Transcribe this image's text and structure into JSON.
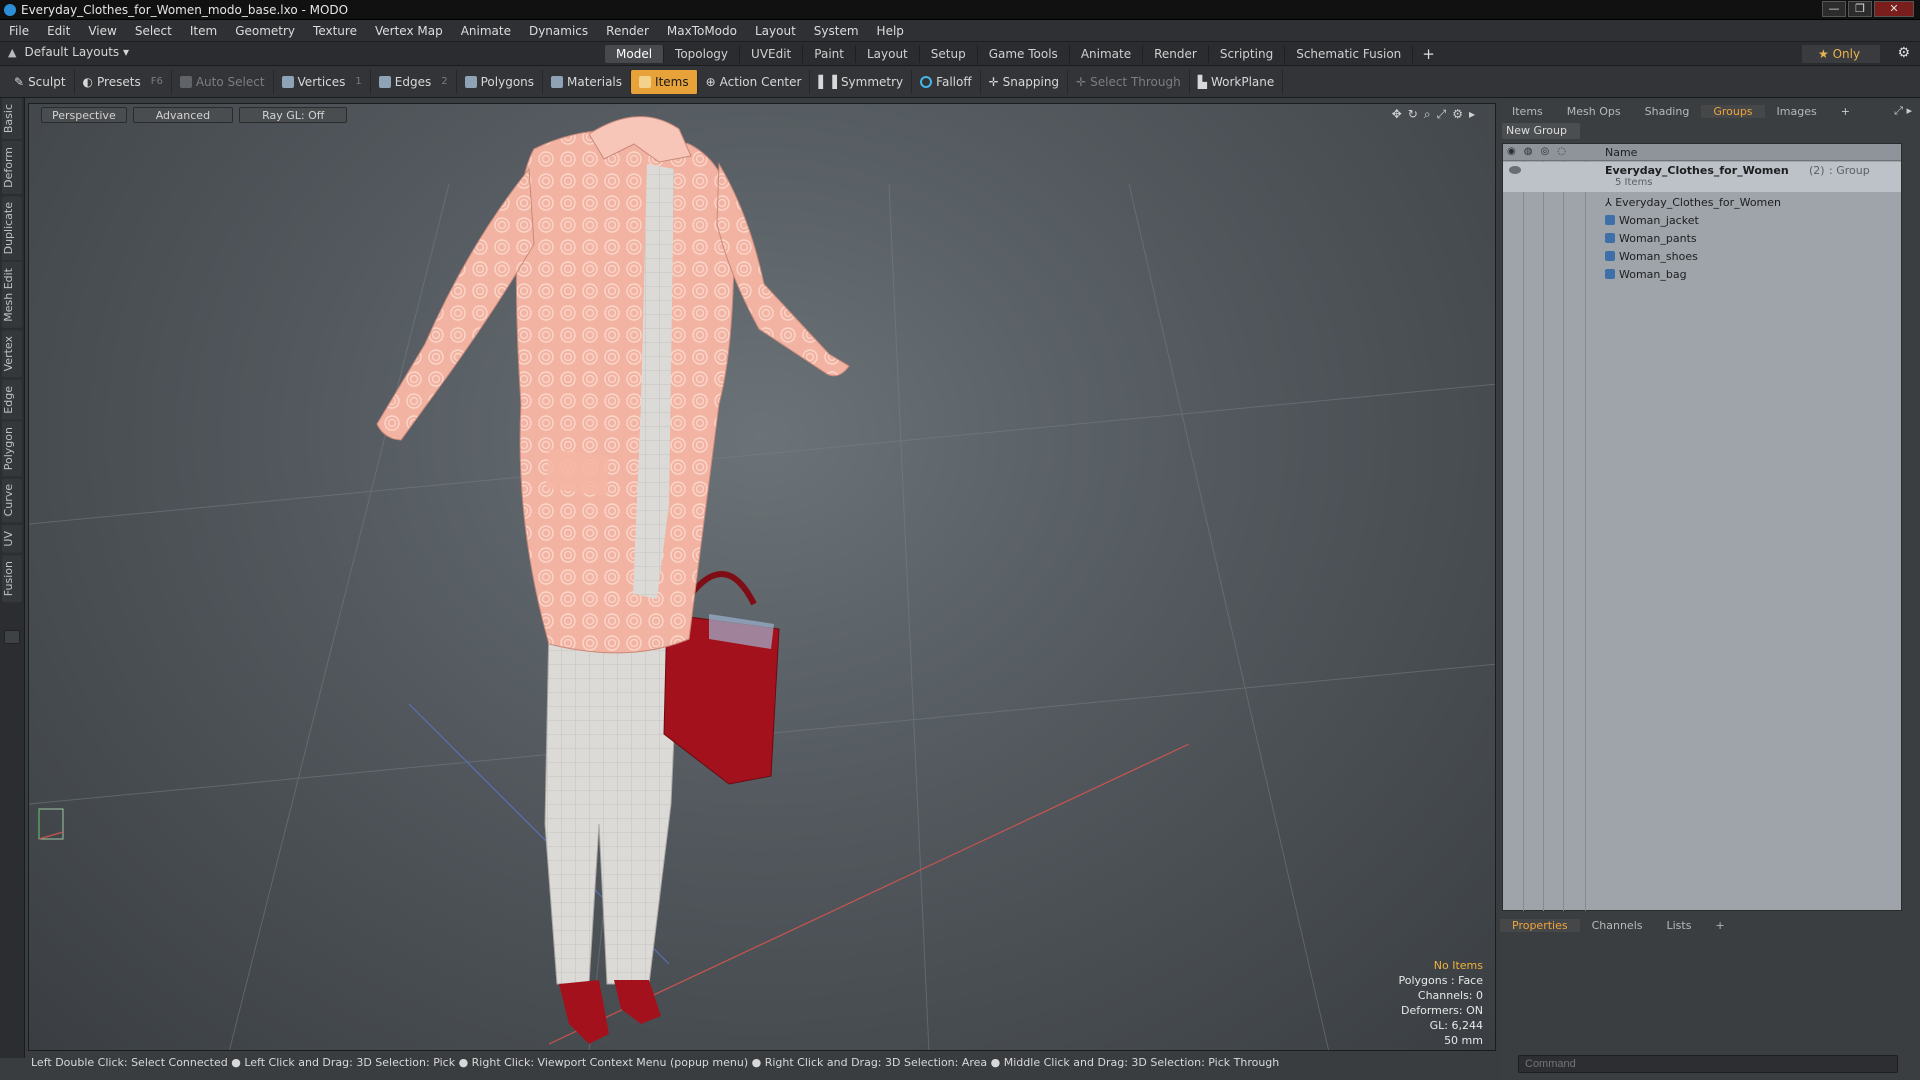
{
  "window": {
    "title": "Everyday_Clothes_for_Women_modo_base.lxo - MODO",
    "buttons": [
      "—",
      "❐",
      "✕"
    ]
  },
  "menu": [
    "File",
    "Edit",
    "View",
    "Select",
    "Item",
    "Geometry",
    "Texture",
    "Vertex Map",
    "Animate",
    "Dynamics",
    "Render",
    "MaxToModo",
    "Layout",
    "System",
    "Help"
  ],
  "layouts": {
    "label": "Default Layouts ▾"
  },
  "main_tabs": [
    "Model",
    "Topology",
    "UVEdit",
    "Paint",
    "Layout",
    "Setup",
    "Game Tools",
    "Animate",
    "Render",
    "Scripting",
    "Schematic Fusion"
  ],
  "main_tab_plus": "+",
  "only_label": "★  Only",
  "toolbar": {
    "sculpt": "Sculpt",
    "presets": "Presets",
    "presets_key": "F6",
    "auto_select": "Auto Select",
    "vertices": "Vertices",
    "vertices_key": "1",
    "edges": "Edges",
    "edges_key": "2",
    "polygons": "Polygons",
    "materials": "Materials",
    "items": "Items",
    "action_center": "Action Center",
    "symmetry": "Symmetry",
    "falloff": "Falloff",
    "snapping": "Snapping",
    "select_through": "Select Through",
    "workplane": "WorkPlane"
  },
  "left_tabs": [
    "Basic",
    "Deform",
    "Duplicate",
    "Mesh Edit",
    "Vertex",
    "Edge",
    "Polygon",
    "Curve",
    "UV",
    "Fusion"
  ],
  "viewport": {
    "tabs": [
      "Perspective",
      "Advanced",
      "Ray GL: Off"
    ],
    "hud": {
      "no_items": "No Items",
      "polygons": "Polygons : Face",
      "channels": "Channels: 0",
      "deformers": "Deformers: ON",
      "gl": "GL: 6,244",
      "focal": "50 mm"
    }
  },
  "status_bar": "Left Double Click: Select Connected ● Left Click and Drag: 3D Selection: Pick ● Right Click: Viewport Context Menu (popup menu) ● Right Click and Drag: 3D Selection: Area ● Middle Click and Drag: 3D Selection: Pick Through",
  "right_panel": {
    "tabs": [
      "Items",
      "Mesh Ops",
      "Shading",
      "Groups",
      "Images"
    ],
    "active_tab": "Groups",
    "tab_plus": "+",
    "new_group": "New Group",
    "column_name": "Name",
    "group": {
      "name": "Everyday_Clothes_for_Women",
      "count": "(2)",
      "type": ": Group",
      "sub": "5 Items"
    },
    "items": [
      "Everyday_Clothes_for_Women",
      "Woman_jacket",
      "Woman_pants",
      "Woman_shoes",
      "Woman_bag"
    ]
  },
  "bottom_tabs": [
    "Properties",
    "Channels",
    "Lists"
  ],
  "bottom_tab_plus": "+",
  "command_placeholder": "Command",
  "colors": {
    "accent": "#f0a43a",
    "items_active": "#e8a23a",
    "jacket": "#f2b3a2",
    "bag": "#a3121c",
    "pants": "#dcdad6"
  }
}
